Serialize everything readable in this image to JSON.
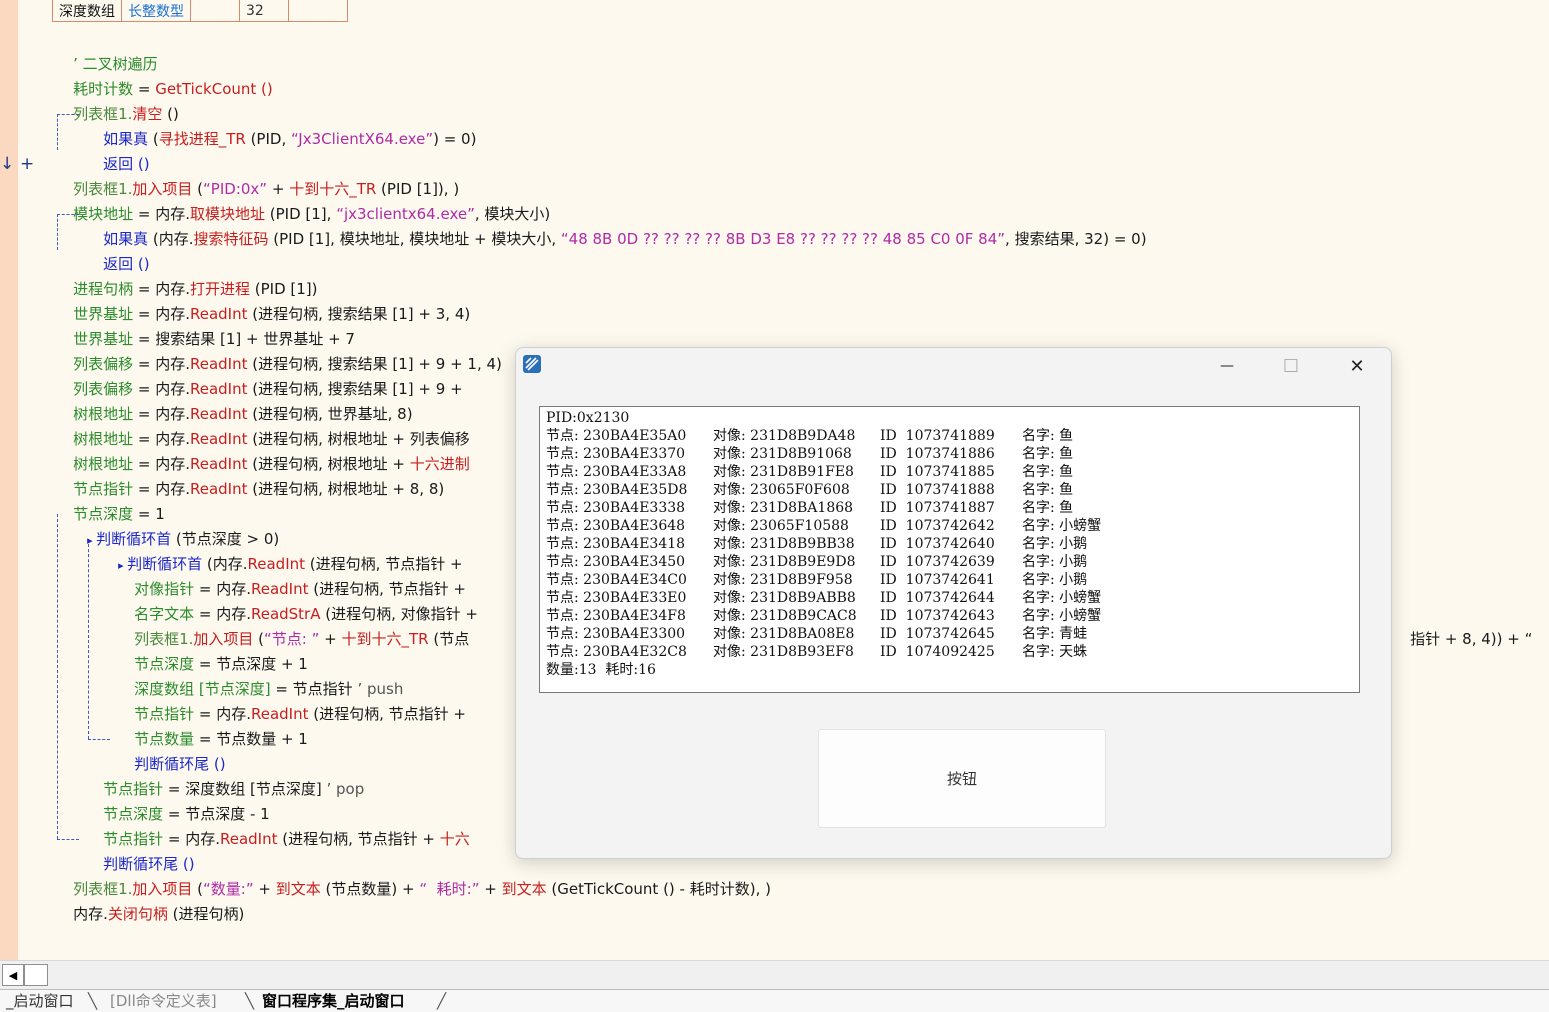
{
  "var_table": {
    "name": "深度数组",
    "type": "长整数型",
    "blank": "",
    "size": "32",
    "blank2": ""
  },
  "code": {
    "l01": "’ 二叉树遍历",
    "l02a": "耗时计数",
    "l02b": " = ",
    "l02c": "GetTickCount ()",
    "l03a": "列表框1.",
    "l03b": "清空",
    "l03c": " ()",
    "l04a": "如果真",
    "l04b": " (",
    "l04c": "寻找进程_TR",
    "l04d": " (PID, ",
    "l04e": "“Jx3ClientX64.exe”",
    "l04f": ") = 0)",
    "l05": "返回 ()",
    "l06a": "列表框1.",
    "l06b": "加入项目",
    "l06c": " (",
    "l06d": "“PID:0x”",
    "l06e": " + ",
    "l06f": "十到十六_TR",
    "l06g": " (PID [1]), )",
    "l07a": "模块地址",
    "l07b": " = ",
    "l07c": "内存.",
    "l07d": "取模块地址",
    "l07e": " (PID [1], ",
    "l07f": "“jx3clientx64.exe”",
    "l07g": ", 模块大小)",
    "l08a": "如果真",
    "l08b": " (内存.",
    "l08c": "搜索特征码",
    "l08d": " (PID [1], 模块地址, 模块地址 + 模块大小, ",
    "l08e": "“48 8B 0D ?? ?? ?? ?? 8B D3 E8 ?? ?? ?? ?? 48 85 C0 0F 84”",
    "l08f": ", 搜索结果, 32) = 0)",
    "l09": "返回 ()",
    "l10a": "进程句柄",
    "l10b": " = 内存.",
    "l10c": "打开进程",
    "l10d": " (PID [1])",
    "l11a": "世界基址",
    "l11b": " = 内存.",
    "l11c": "ReadInt",
    "l11d": " (进程句柄, 搜索结果 [1] + 3, 4)",
    "l12a": "世界基址",
    "l12b": " = 搜索结果 [1] + 世界基址 + 7",
    "l13a": "列表偏移",
    "l13b": " = 内存.",
    "l13c": "ReadInt",
    "l13d": " (进程句柄, 搜索结果 [1] + 9 + 1, 4)",
    "l14a": "列表偏移",
    "l14b": " = 内存.",
    "l14c": "ReadInt",
    "l14d": " (进程句柄, 搜索结果 [1] + 9 +",
    "l15a": "树根地址",
    "l15b": " = 内存.",
    "l15c": "ReadInt",
    "l15d": " (进程句柄, 世界基址, 8)",
    "l16a": "树根地址",
    "l16b": " = 内存.",
    "l16c": "ReadInt",
    "l16d": " (进程句柄, 树根地址 + 列表偏移",
    "l17a": "树根地址",
    "l17b": " = 内存.",
    "l17c": "ReadInt",
    "l17d": " (进程句柄, 树根地址 + ",
    "l17e": "十六进制",
    "l18a": "节点指针",
    "l18b": " = 内存.",
    "l18c": "ReadInt",
    "l18d": " (进程句柄, 树根地址 + 8, 8)",
    "l19a": "节点深度",
    "l19b": " = 1",
    "l20a": "判断循环首",
    "l20b": " (节点深度 > 0)",
    "l21a": "判断循环首",
    "l21b": " (内存.",
    "l21c": "ReadInt",
    "l21d": " (进程句柄, 节点指针 +",
    "l22a": "对像指针",
    "l22b": " = 内存.",
    "l22c": "ReadInt",
    "l22d": " (进程句柄, 节点指针 +",
    "l23a": "名字文本",
    "l23b": " = 内存.",
    "l23c": "ReadStrA",
    "l23d": " (进程句柄, 对像指针 +",
    "l24a": "列表框1.",
    "l24b": "加入项目",
    "l24c": " (",
    "l24d": "“节点: ”",
    "l24e": " + ",
    "l24f": "十到十六_TR",
    "l24g": " (节点",
    "l24tail": "指针 + 8, 4)) + “",
    "l25a": "节点深度",
    "l25b": " = 节点深度 + 1",
    "l26a": "深度数组 [节点深度]",
    "l26b": " = 节点指针 ",
    "l26c": "’ push",
    "l27a": "节点指针",
    "l27b": " = 内存.",
    "l27c": "ReadInt",
    "l27d": " (进程句柄, 节点指针 +",
    "l28a": "节点数量",
    "l28b": " = 节点数量 + 1",
    "l29": "判断循环尾 ()",
    "l30a": "节点指针",
    "l30b": " = 深度数组 [节点深度] ",
    "l30c": "’ pop",
    "l31a": "节点深度",
    "l31b": " = 节点深度 - 1",
    "l32a": "节点指针",
    "l32b": " = 内存.",
    "l32c": "ReadInt",
    "l32d": " (进程句柄, 节点指针 + ",
    "l32e": "十六",
    "l33": "判断循环尾 ()",
    "l34a": "列表框1.",
    "l34b": "加入项目",
    "l34c": " (",
    "l34d": "“数量:”",
    "l34e": " + ",
    "l34f": "到文本",
    "l34g": " (节点数量) + ",
    "l34h": "“  耗时:”",
    "l34i": " + ",
    "l34j": "到文本",
    "l34k": " (GetTickCount () - 耗时计数), )",
    "l35a": "内存.",
    "l35b": "关闭句柄",
    "l35c": " (进程句柄)"
  },
  "gutter": {
    "arrow": "↓",
    "plus": "+"
  },
  "window": {
    "title": "",
    "minimize": "—",
    "maximize": "☐",
    "close": "✕",
    "list_header": "PID:0x2130",
    "rows": [
      {
        "node": "节点: 230BA4E35A0",
        "obj": "对像: 231D8B9DA48",
        "id": "ID  1073741889",
        "name": "名字: 鱼"
      },
      {
        "node": "节点: 230BA4E3370",
        "obj": "对像: 231D8B91068",
        "id": "ID  1073741886",
        "name": "名字: 鱼"
      },
      {
        "node": "节点: 230BA4E33A8",
        "obj": "对像: 231D8B91FE8",
        "id": "ID  1073741885",
        "name": "名字: 鱼"
      },
      {
        "node": "节点: 230BA4E35D8",
        "obj": "对像: 23065F0F608",
        "id": "ID  1073741888",
        "name": "名字: 鱼"
      },
      {
        "node": "节点: 230BA4E3338",
        "obj": "对像: 231D8BA1868",
        "id": "ID  1073741887",
        "name": "名字: 鱼"
      },
      {
        "node": "节点: 230BA4E3648",
        "obj": "对像: 23065F10588",
        "id": "ID  1073742642",
        "name": "名字: 小螃蟹"
      },
      {
        "node": "节点: 230BA4E3418",
        "obj": "对像: 231D8B9BB38",
        "id": "ID  1073742640",
        "name": "名字: 小鹅"
      },
      {
        "node": "节点: 230BA4E3450",
        "obj": "对像: 231D8B9E9D8",
        "id": "ID  1073742639",
        "name": "名字: 小鹅"
      },
      {
        "node": "节点: 230BA4E34C0",
        "obj": "对像: 231D8B9F958",
        "id": "ID  1073742641",
        "name": "名字: 小鹅"
      },
      {
        "node": "节点: 230BA4E33E0",
        "obj": "对像: 231D8B9ABB8",
        "id": "ID  1073742644",
        "name": "名字: 小螃蟹"
      },
      {
        "node": "节点: 230BA4E34F8",
        "obj": "对像: 231D8B9CAC8",
        "id": "ID  1073742643",
        "name": "名字: 小螃蟹"
      },
      {
        "node": "节点: 230BA4E3300",
        "obj": "对像: 231D8BA08E8",
        "id": "ID  1073742645",
        "name": "名字: 青蛙"
      },
      {
        "node": "节点: 230BA4E32C8",
        "obj": "对像: 231D8B93EF8",
        "id": "ID  1074092425",
        "name": "名字: 天蛛"
      }
    ],
    "list_footer": "数量:13  耗时:16",
    "button_label": "按钮"
  },
  "tabs": {
    "t1": "_启动窗口",
    "t2": "[Dll命令定义表]",
    "t3": "窗口程序集_启动窗口"
  },
  "scroll": {
    "left_arrow": "◀"
  },
  "colors": {
    "editor_bg": "#fdf9ef",
    "gutter": "#fbd9c0",
    "keyword_blue": "#1c28c9",
    "var_green": "#2b8c2b",
    "string_magenta": "#b02ba6",
    "fn_red": "#c81e1e"
  }
}
